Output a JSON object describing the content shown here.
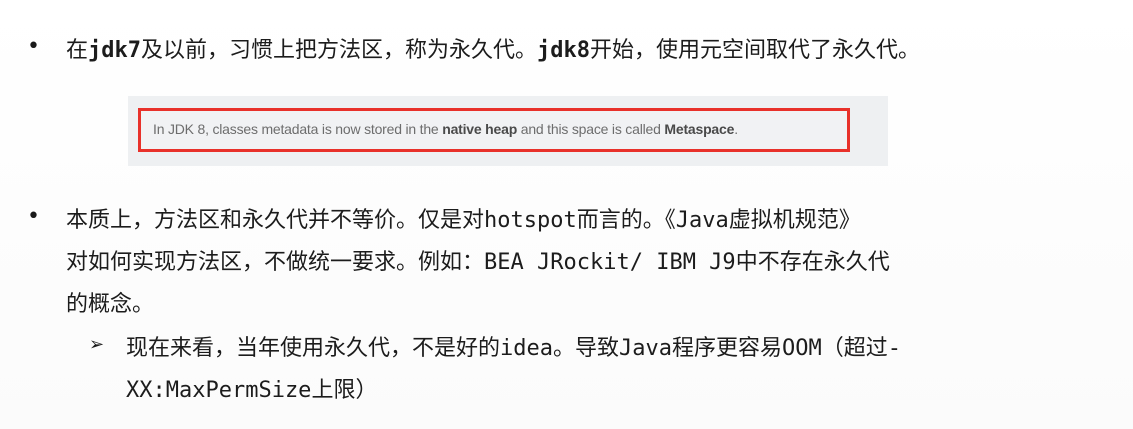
{
  "bullet1": {
    "marker": "•",
    "p1": "在",
    "p2": "jdk7",
    "p3": "及以前，习惯上把方法区，称为永久代。",
    "p4": "jdk8",
    "p5": "开始，使用元空间取代了永久代。"
  },
  "quote": {
    "q1": "In JDK 8, classes metadata is now stored in the ",
    "q2": "native heap",
    "q3": " and this space is called ",
    "q4": "Metaspace",
    "q5": "."
  },
  "bullet2": {
    "marker": "•",
    "line1a": "本质上，方法区和永久代并不等价。仅是对",
    "line1b": "hotspot",
    "line1c": "而言的。《",
    "line1d": "Java",
    "line1e": "虚拟机规范》",
    "line2a": "对如何实现方法区，不做统一要求。例如：",
    "line2b": "BEA JRockit/ IBM J9",
    "line2c": "中不存在永久代",
    "line3": "的概念。"
  },
  "sub": {
    "marker": "➢",
    "line1a": "现在来看，当年使用永久代，不是好的",
    "line1b": "idea",
    "line1c": "。导致",
    "line1d": "Java",
    "line1e": "程序更容易",
    "line1f": "OOM",
    "line1g": "（超过",
    "line1h": "-",
    "line2a": "XX:MaxPermSize",
    "line2b": "上限）"
  }
}
